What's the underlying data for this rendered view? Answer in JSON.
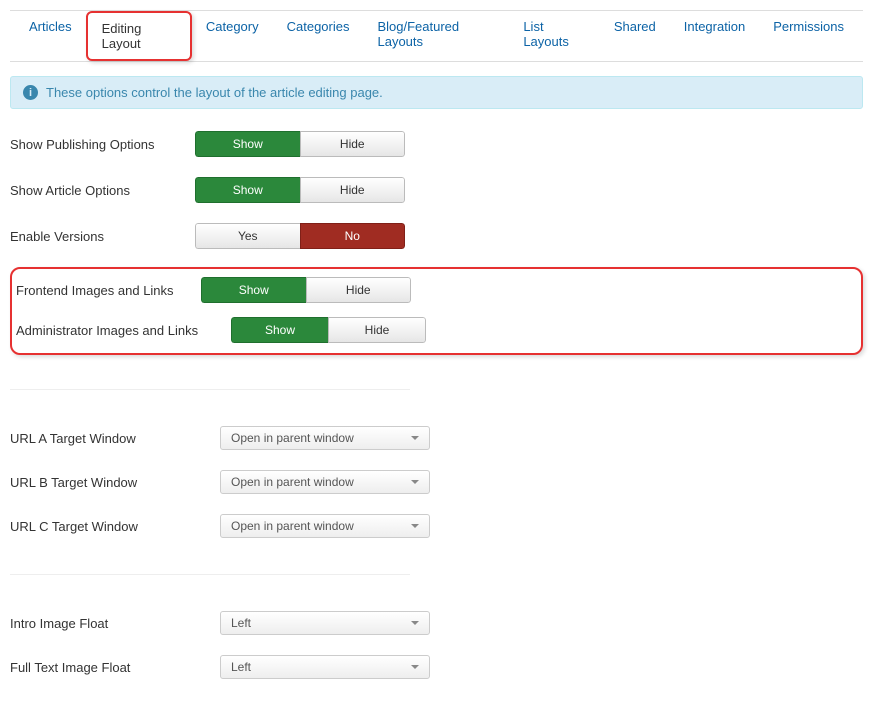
{
  "tabs": {
    "articles": "Articles",
    "editing_layout": "Editing Layout",
    "category": "Category",
    "categories": "Categories",
    "blog_featured": "Blog/Featured Layouts",
    "list_layouts": "List Layouts",
    "shared": "Shared",
    "integration": "Integration",
    "permissions": "Permissions"
  },
  "alert": {
    "text": "These options control the layout of the article editing page."
  },
  "fields": {
    "show_publishing": {
      "label": "Show Publishing Options",
      "on": "Show",
      "off": "Hide",
      "value": "Show"
    },
    "show_article": {
      "label": "Show Article Options",
      "on": "Show",
      "off": "Hide",
      "value": "Show"
    },
    "enable_versions": {
      "label": "Enable Versions",
      "on": "Yes",
      "off": "No",
      "value": "No"
    },
    "frontend_images": {
      "label": "Frontend Images and Links",
      "on": "Show",
      "off": "Hide",
      "value": "Show"
    },
    "admin_images": {
      "label": "Administrator Images and Links",
      "on": "Show",
      "off": "Hide",
      "value": "Show"
    },
    "url_a": {
      "label": "URL A Target Window",
      "value": "Open in parent window"
    },
    "url_b": {
      "label": "URL B Target Window",
      "value": "Open in parent window"
    },
    "url_c": {
      "label": "URL C Target Window",
      "value": "Open in parent window"
    },
    "intro_float": {
      "label": "Intro Image Float",
      "value": "Left"
    },
    "full_float": {
      "label": "Full Text Image Float",
      "value": "Left"
    }
  }
}
